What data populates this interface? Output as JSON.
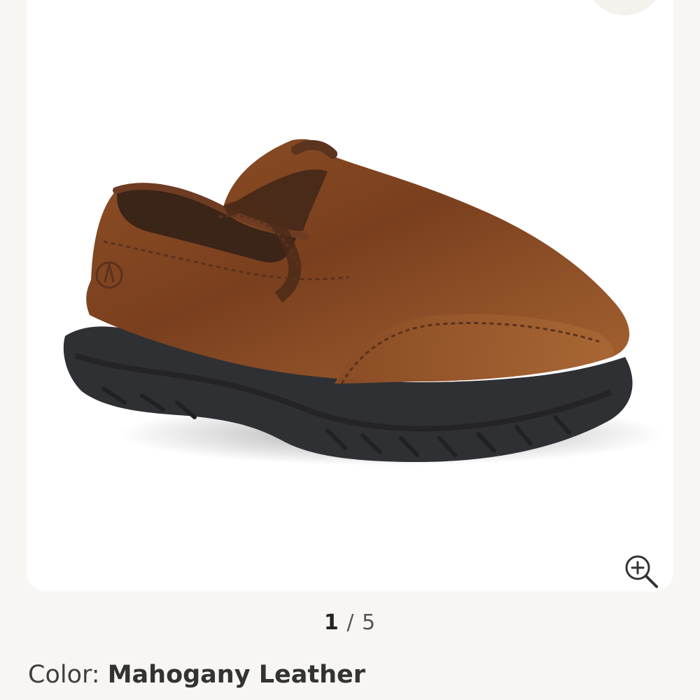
{
  "product": {
    "image_alt": "Mahogany leather slip-on shoe",
    "wishlist_icon": "heart-icon",
    "zoom_icon": "zoom-in-icon"
  },
  "gallery": {
    "current": "1",
    "separator": "/",
    "total": "5"
  },
  "color": {
    "label": "Color:",
    "value": "Mahogany Leather"
  },
  "colors": {
    "page_background": "#f8f6f3",
    "card_background": "#ffffff",
    "leather": "#8b4a22",
    "sole": "#2f3033"
  }
}
